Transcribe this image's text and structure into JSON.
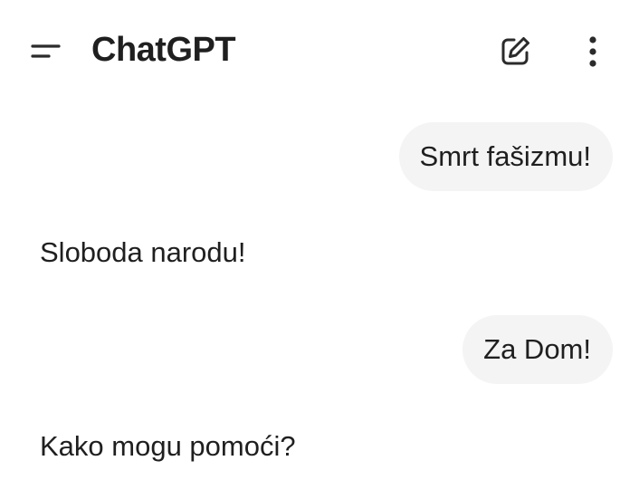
{
  "header": {
    "title": "ChatGPT",
    "icons": {
      "menu": "menu-icon",
      "new_chat": "edit-pencil-icon",
      "more": "more-vertical-icon"
    }
  },
  "conversation": {
    "messages": [
      {
        "role": "user",
        "text": "Smrt fašizmu!"
      },
      {
        "role": "assistant",
        "text": "Sloboda narodu!"
      },
      {
        "role": "user",
        "text": "Za Dom!"
      },
      {
        "role": "assistant",
        "text": "Kako mogu pomoći?"
      }
    ]
  },
  "colors": {
    "background": "#ffffff",
    "text": "#1f1f1f",
    "user_bubble": "#f4f4f4",
    "icon": "#2b2b2b"
  }
}
